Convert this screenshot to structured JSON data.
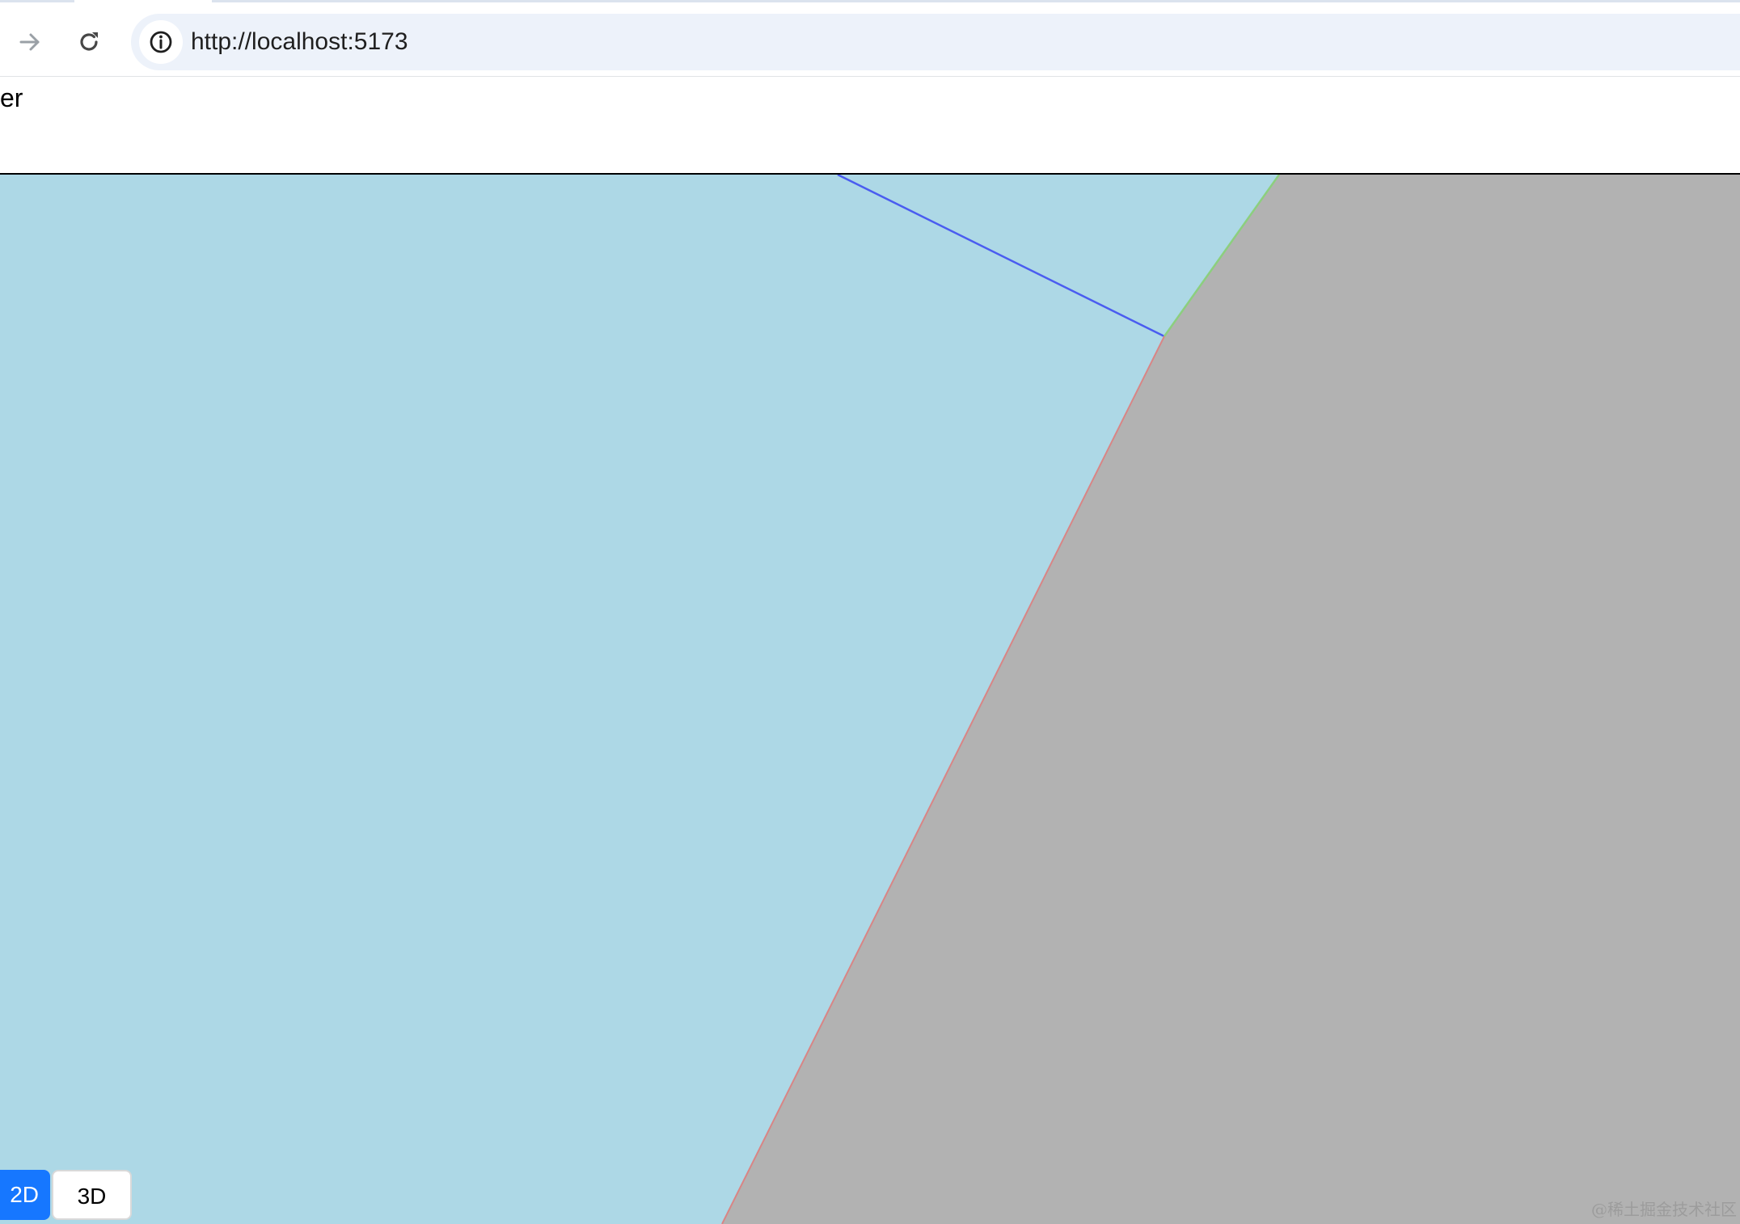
{
  "browser": {
    "url": "http://localhost:5173",
    "icons": {
      "forward": "arrow-right-icon",
      "reload": "reload-icon",
      "site_info": "info-icon"
    }
  },
  "page": {
    "header_text": "er"
  },
  "scene": {
    "colors": {
      "water": "#add8e6",
      "land": "#b2b2b2",
      "edge_blue": "#4a5cf0",
      "edge_green": "#8ccf7e",
      "edge_red": "#d98585"
    }
  },
  "controls": {
    "mode_2d_label": "2D",
    "mode_3d_label": "3D",
    "active_mode": "2D",
    "active_color": "#1677ff"
  },
  "watermark": {
    "text": "@稀土掘金技术社区"
  }
}
